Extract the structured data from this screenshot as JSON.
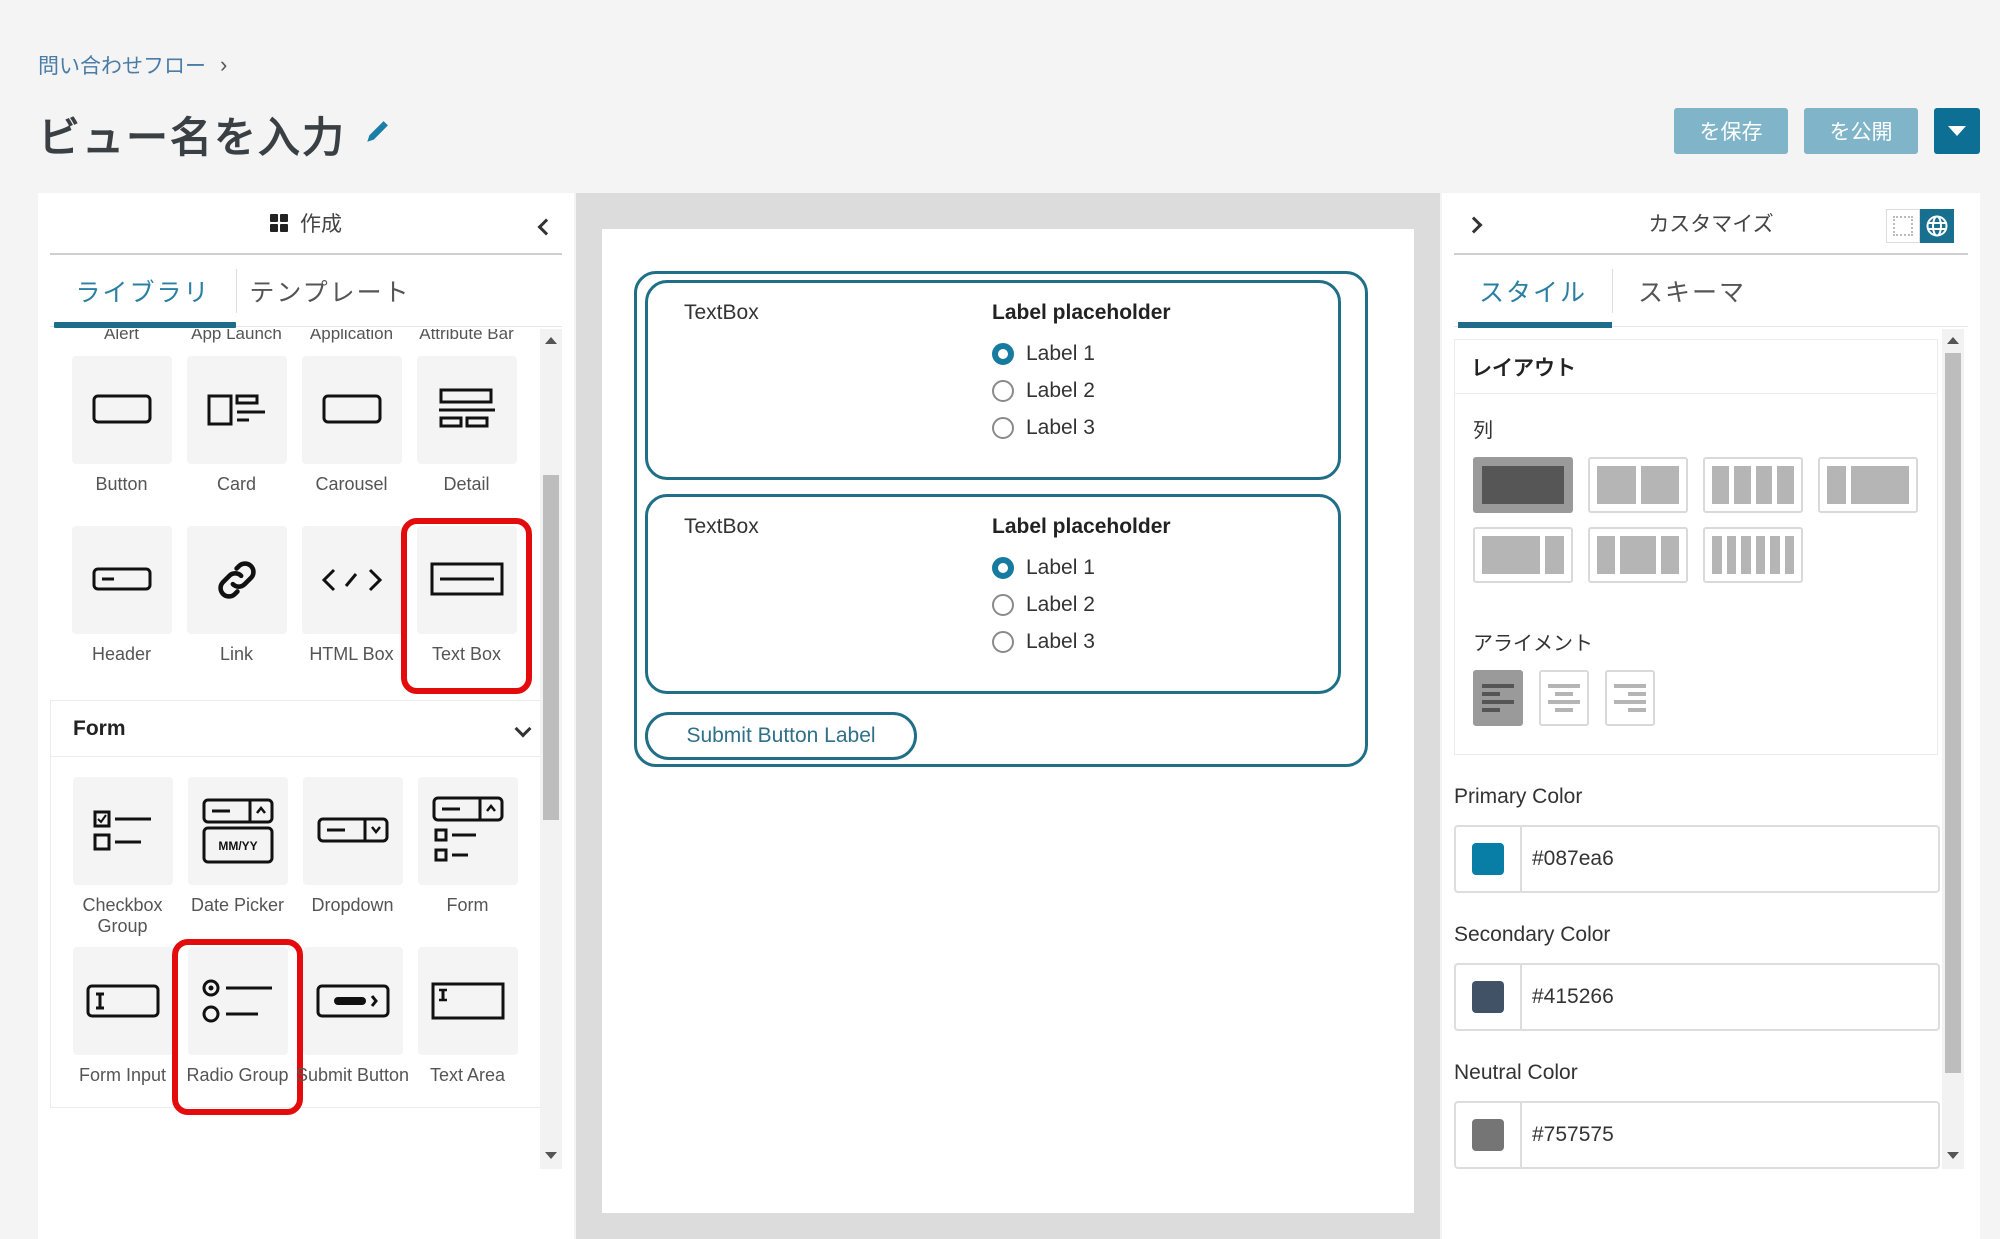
{
  "breadcrumb": {
    "parent": "問い合わせフロー"
  },
  "page": {
    "title": "ビュー名を入力"
  },
  "actions": {
    "save_label": "を保存",
    "publish_label": "を公開"
  },
  "left_panel": {
    "title": "作成",
    "tabs": [
      {
        "label": "ライブラリ",
        "active": true
      },
      {
        "label": "テンプレート",
        "active": false
      }
    ],
    "partial_row": [
      "Alert",
      "App Launch",
      "Application",
      "Attribute Bar"
    ],
    "basic_components": [
      {
        "label": "Button",
        "icon": "button-icon"
      },
      {
        "label": "Card",
        "icon": "card-icon"
      },
      {
        "label": "Carousel",
        "icon": "carousel-icon"
      },
      {
        "label": "Detail",
        "icon": "detail-icon"
      },
      {
        "label": "Header",
        "icon": "header-icon"
      },
      {
        "label": "Link",
        "icon": "link-icon"
      },
      {
        "label": "HTML Box",
        "icon": "code-icon"
      },
      {
        "label": "Text Box",
        "icon": "text-box-icon",
        "highlighted": true
      }
    ],
    "form_section": {
      "title": "Form",
      "components": [
        {
          "label": "Checkbox Group",
          "icon": "checkbox-group-icon"
        },
        {
          "label": "Date Picker",
          "icon": "date-picker-icon",
          "icon_text": "MM/YY"
        },
        {
          "label": "Dropdown",
          "icon": "dropdown-icon"
        },
        {
          "label": "Form",
          "icon": "form-icon"
        },
        {
          "label": "Form Input",
          "icon": "form-input-icon"
        },
        {
          "label": "Radio Group",
          "icon": "radio-group-icon",
          "highlighted": true
        },
        {
          "label": "Submit Button",
          "icon": "submit-button-icon"
        },
        {
          "label": "Text Area",
          "icon": "text-area-icon"
        }
      ]
    }
  },
  "canvas": {
    "rows": [
      {
        "textbox": "TextBox",
        "radio_title": "Label placeholder",
        "options": [
          "Label 1",
          "Label 2",
          "Label 3"
        ],
        "selected": 0
      },
      {
        "textbox": "TextBox",
        "radio_title": "Label placeholder",
        "options": [
          "Label 1",
          "Label 2",
          "Label 3"
        ],
        "selected": 0
      }
    ],
    "submit_label": "Submit Button Label"
  },
  "right_panel": {
    "title": "カスタマイズ",
    "tabs": [
      {
        "label": "スタイル",
        "active": true
      },
      {
        "label": "スキーマ",
        "active": false
      }
    ],
    "layout": {
      "title": "レイアウト",
      "columns_label": "列",
      "column_options": [
        "1",
        "1-1",
        "1-1-1-1",
        "1-3",
        "3-1",
        "1-2-1",
        "1-1-1-1-1-1"
      ],
      "selected_column": 0,
      "alignment_label": "アライメント",
      "alignment_options": [
        "left",
        "center",
        "right"
      ],
      "selected_alignment": 0
    },
    "colors": [
      {
        "label": "Primary Color",
        "value": "#087ea6"
      },
      {
        "label": "Secondary Color",
        "value": "#415266"
      },
      {
        "label": "Neutral Color",
        "value": "#757575"
      }
    ]
  }
}
